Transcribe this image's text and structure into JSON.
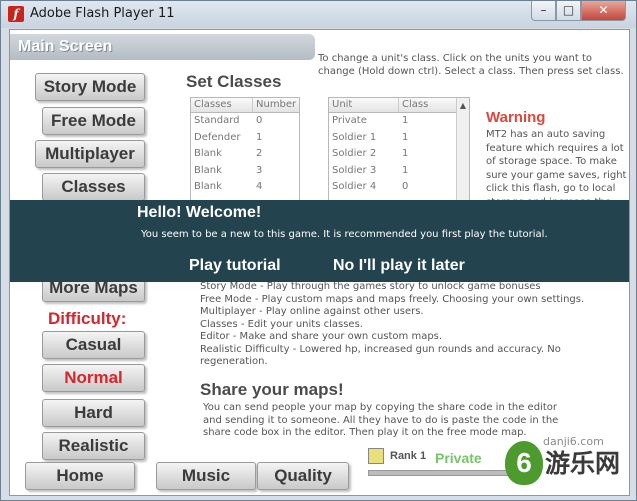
{
  "window": {
    "title": "Adobe Flash Player 11",
    "logo_glyph": "f",
    "minimize": "–",
    "maximize": "□",
    "close": "✕"
  },
  "main_title": "Main Screen",
  "menu": {
    "story_mode": "Story Mode",
    "free_mode": "Free Mode",
    "multiplayer": "Multiplayer",
    "classes": "Classes",
    "more_maps": "More Maps",
    "difficulty_label": "Difficulty:",
    "casual": "Casual",
    "normal": "Normal",
    "hard": "Hard",
    "realistic": "Realistic",
    "home": "Home",
    "music": "Music",
    "quality": "Quality"
  },
  "intro": "To change a unit's class. Click on the units you want to change (Hold down ctrl). Select a class. Then press set class.",
  "set_classes": {
    "title": "Set Classes",
    "classes_table": {
      "headers": [
        "Classes",
        "Number"
      ],
      "rows": [
        [
          "Standard",
          "0"
        ],
        [
          "Defender",
          "1"
        ],
        [
          "Blank",
          "2"
        ],
        [
          "Blank",
          "3"
        ],
        [
          "Blank",
          "4"
        ]
      ]
    },
    "units_table": {
      "headers": [
        "Unit",
        "Class"
      ],
      "rows": [
        [
          "Private",
          "1"
        ],
        [
          "Soldier 1",
          "1"
        ],
        [
          "Soldier 2",
          "1"
        ],
        [
          "Soldier 3",
          "1"
        ],
        [
          "Soldier 4",
          "0"
        ]
      ]
    }
  },
  "warning": {
    "title": "Warning",
    "text": "MT2 has an auto saving feature which requires a lot of storage space. To make sure your game saves, right click this flash, go to local storage and increase the maximum limit."
  },
  "welcome": {
    "title": "Hello! Welcome!",
    "message": "You seem to be a new to this game. It is recommended you first play the tutorial.",
    "play_tutorial": "Play tutorial",
    "decline": "No I'll play it later"
  },
  "mode_info": [
    "Story Mode - Play through the games story to unlock game bonuses",
    "Free Mode - Play custom maps and maps freely. Choosing your own settings.",
    "Multiplayer - Play online against other users.",
    "Classes - Edit your units classes.",
    "Editor - Make and share your own custom maps.",
    "Realistic Difficulty - Lowered hp, increased gun rounds and accuracy. No regeneration."
  ],
  "share": {
    "title": "Share your maps!",
    "text": "You can send people your map by copying the share code in the editor and sending it to someone. All they have to do is paste the code in the share code box in the editor. Then play it on the free mode map."
  },
  "rank": {
    "label": "Rank 1",
    "class_name": "Private",
    "progress": 0.0
  },
  "watermark": {
    "domain": "danji6.com",
    "name": "游乐网",
    "glyph": "6"
  },
  "colors": {
    "accent_red": "#d7262c",
    "overlay": "#23434f",
    "rank_green": "#79c46a"
  }
}
